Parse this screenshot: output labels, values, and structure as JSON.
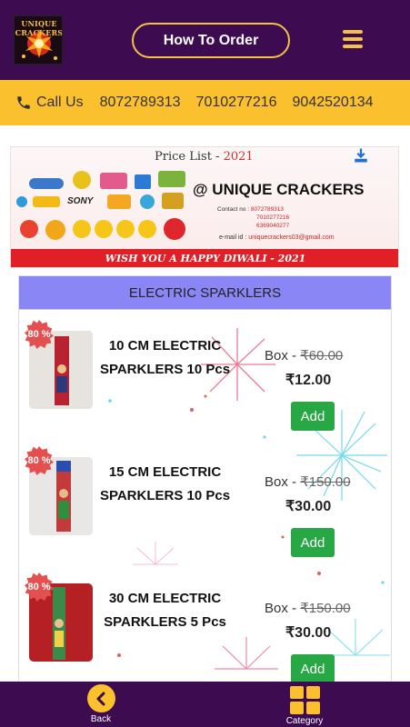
{
  "header": {
    "logo_text": "UNIQUE CRACKERS",
    "how_to_order_label": "How To Order",
    "menu_icon": "hamburger-menu-icon"
  },
  "callbar": {
    "label": "Call Us",
    "icon": "phone-icon",
    "numbers": [
      "8072789313",
      "7010277216",
      "9042520134"
    ]
  },
  "banner": {
    "title": "Price List - ",
    "year": "2021",
    "brand": "@ UNIQUE CRACKERS",
    "contact_label": "Contact no :",
    "contact_numbers": [
      "8072789313",
      "7010277216",
      "6369040277"
    ],
    "email_label": "e-mail id :",
    "email": "uniquecrackers03@gmail.com",
    "wish": "WISH YOU A HAPPY DIWALI - 2021",
    "download_icon": "download-icon"
  },
  "category": {
    "name": "ELECTRIC SPARKLERS"
  },
  "products": [
    {
      "name": "10 CM ELECTRIC SPARKLERS 10 Pcs",
      "discount": "80 %",
      "unit": "Box - ",
      "mrp": "₹60.00",
      "price": "₹12.00",
      "add_label": "Add"
    },
    {
      "name": "15 CM ELECTRIC SPARKLERS 10 Pcs",
      "discount": "80 %",
      "unit": "Box - ",
      "mrp": "₹150.00",
      "price": "₹30.00",
      "add_label": "Add"
    },
    {
      "name": "30 CM ELECTRIC SPARKLERS 5 Pcs",
      "discount": "80 %",
      "unit": "Box - ",
      "mrp": "₹150.00",
      "price": "₹30.00",
      "add_label": "Add"
    }
  ],
  "bottom_nav": {
    "back_label": "Back",
    "category_label": "Category"
  },
  "colors": {
    "header_bg": "#3d0b4f",
    "accent_yellow": "#fbc02d",
    "category_header": "#8b86f5",
    "add_button": "#28a745",
    "badge_red": "#e44f4f"
  }
}
